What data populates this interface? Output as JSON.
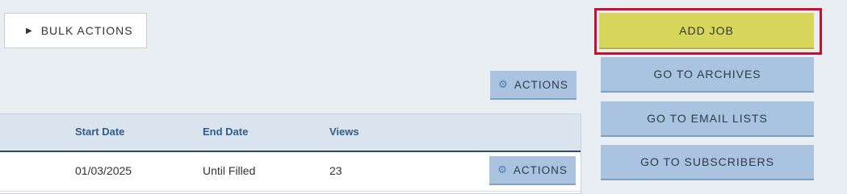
{
  "toolbar": {
    "bulk_actions_label": "BULK ACTIONS",
    "actions_label": "ACTIONS"
  },
  "sidebar": {
    "add_job_label": "ADD JOB",
    "go_to_archives_label": "GO TO ARCHIVES",
    "go_to_email_lists_label": "GO TO EMAIL LISTS",
    "go_to_subscribers_label": "GO TO SUBSCRIBERS"
  },
  "table": {
    "columns": [
      "Start Date",
      "End Date",
      "Views"
    ],
    "rows": [
      {
        "start_date": "01/03/2025",
        "end_date": "Until Filled",
        "views": "23",
        "actions_label": "ACTIONS"
      }
    ]
  },
  "colors": {
    "add_job": "#d6d65a",
    "secondary_button": "#a9c3e0",
    "focus_outline": "#c8102e",
    "header_text": "#2d5d88"
  },
  "icons": [
    "play-icon",
    "gear-icon"
  ]
}
